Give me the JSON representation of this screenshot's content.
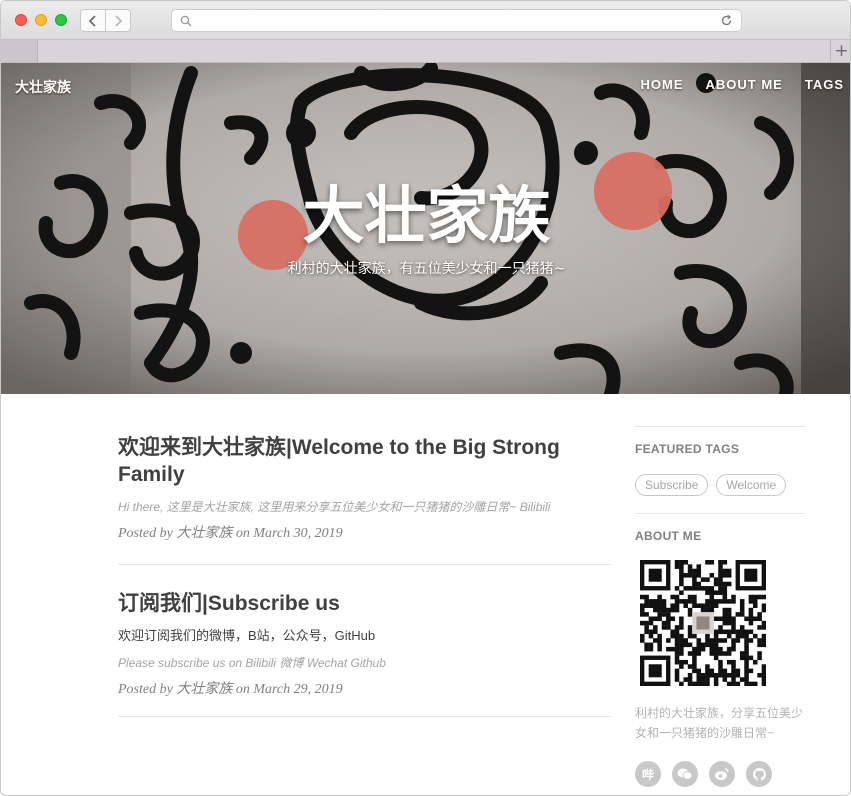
{
  "site": {
    "brand": "大壮家族",
    "nav": [
      {
        "label": "HOME"
      },
      {
        "label": "ABOUT ME"
      },
      {
        "label": "TAGS"
      }
    ]
  },
  "hero": {
    "title": "大壮家族",
    "subtitle": "利村的大壮家族，有五位美少女和一只猪猪~"
  },
  "posts": [
    {
      "title": "欢迎来到大壮家族|Welcome to the Big Strong Family",
      "subtitle": "Hi there, 这里是大壮家族, 这里用来分享五位美少女和一只猪猪的沙雕日常~ Bilibili",
      "meta": "Posted by 大壮家族 on March 30, 2019"
    },
    {
      "title": "订阅我们|Subscribe us",
      "excerpt": "欢迎订阅我们的微博，B站，公众号，GitHub",
      "subtitle": "Please subscribe us on Bilibili 微博 Wechat Github",
      "meta": "Posted by 大壮家族 on March 29, 2019"
    }
  ],
  "sidebar": {
    "featured_tags_heading": "FEATURED TAGS",
    "tags": [
      "Subscribe",
      "Welcome"
    ],
    "about_heading": "ABOUT ME",
    "about_text": "利村的大壮家族，分享五位美少女和一只猪猪的沙雕日常~",
    "social": [
      {
        "icon": "bilibili-icon",
        "glyph": "哔"
      },
      {
        "icon": "wechat-icon",
        "glyph": ""
      },
      {
        "icon": "weibo-icon",
        "glyph": ""
      },
      {
        "icon": "github-icon",
        "glyph": ""
      }
    ]
  }
}
